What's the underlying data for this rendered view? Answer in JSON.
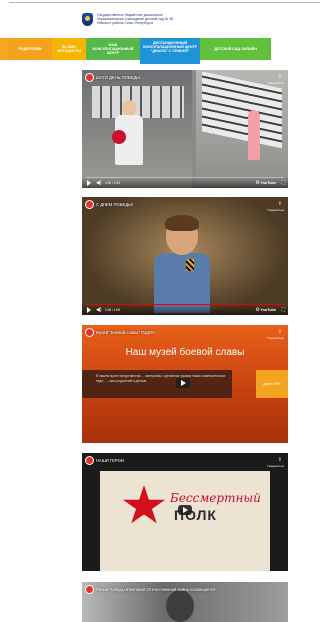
{
  "header": {
    "org_lines": [
      "Государственное бюджетное дошкольное",
      "образовательное учреждение детский сад № 38",
      "Невского района Санкт-Петербурга"
    ]
  },
  "nav": {
    "items": [
      "",
      "РОДИТЕЛЯМ",
      "ВС ЗМО МЕТОДИСТЫ",
      "НАШ КОНСУЛЬТАЦИОННЫЙ ЦЕНТР",
      "ДИСТАНЦИОННЫЙ КОНСУЛЬТАЦИОННЫЙ ЦЕНТР \"ДИАЛОГ С СЕМЬЕЙ\"",
      "ДЕТСКИЙ САД ОНЛАЙН"
    ]
  },
  "videos": [
    {
      "title": "ШАГИ ДЕНЬ ПОБЕДЫ",
      "share": "Поделиться",
      "time": "0:00 / 0:44",
      "progress": 0.0
    },
    {
      "title": "С ДНЕМ ПОБЕДЫ!",
      "share": "Поделиться",
      "time": "1:06 / 1:06",
      "progress": 1.0
    },
    {
      "title": "Музей \"Боевой славы\" ГБДОУ",
      "share": "Поделиться",
      "headline": "Наш музей боевой славы",
      "desc": "В нашем музее представлены ... материалы, сделанные руками наших замечательных педа... ...ских родителей и детьми.",
      "pill": "Далее ИНФ"
    },
    {
      "title": "НАШИ ГЕРОИ",
      "share": "Поделиться",
      "poster_script": "Бессмертный",
      "poster_word": "ПОЛК"
    },
    {
      "title": "Песни Победы в Великой Отечественной войне посвящается..."
    }
  ],
  "player": {
    "youtube": "YouTube"
  }
}
